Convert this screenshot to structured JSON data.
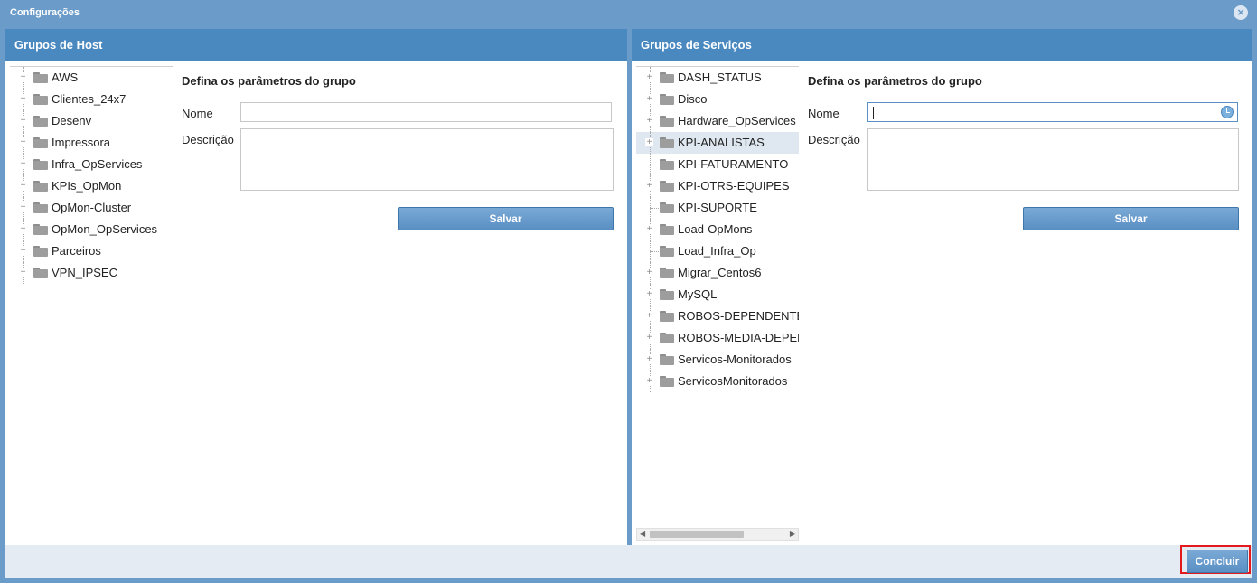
{
  "window": {
    "title": "Configurações",
    "close_icon": "close-icon"
  },
  "host_panel": {
    "header": "Grupos de Host",
    "tree": [
      {
        "label": "AWS",
        "expandable": true
      },
      {
        "label": "Clientes_24x7",
        "expandable": true
      },
      {
        "label": "Desenv",
        "expandable": true
      },
      {
        "label": "Impressora",
        "expandable": true
      },
      {
        "label": "Infra_OpServices",
        "expandable": true
      },
      {
        "label": "KPIs_OpMon",
        "expandable": true
      },
      {
        "label": "OpMon-Cluster",
        "expandable": true
      },
      {
        "label": "OpMon_OpServices",
        "expandable": true
      },
      {
        "label": "Parceiros",
        "expandable": true
      },
      {
        "label": "VPN_IPSEC",
        "expandable": true
      }
    ],
    "form": {
      "title": "Defina os parâmetros do grupo",
      "name_label": "Nome",
      "name_value": "",
      "description_label": "Descrição",
      "description_value": "",
      "save_label": "Salvar"
    }
  },
  "service_panel": {
    "header": "Grupos de Serviços",
    "tree": [
      {
        "label": "DASH_STATUS",
        "expandable": true
      },
      {
        "label": "Disco",
        "expandable": true
      },
      {
        "label": "Hardware_OpServices",
        "expandable": true
      },
      {
        "label": "KPI-ANALISTAS",
        "expandable": true,
        "selected": true
      },
      {
        "label": "KPI-FATURAMENTO",
        "expandable": false
      },
      {
        "label": "KPI-OTRS-EQUIPES",
        "expandable": true
      },
      {
        "label": "KPI-SUPORTE",
        "expandable": false
      },
      {
        "label": "Load-OpMons",
        "expandable": true
      },
      {
        "label": "Load_Infra_Op",
        "expandable": false
      },
      {
        "label": "Migrar_Centos6",
        "expandable": true
      },
      {
        "label": "MySQL",
        "expandable": true
      },
      {
        "label": "ROBOS-DEPENDENTES",
        "expandable": true
      },
      {
        "label": "ROBOS-MEDIA-DEPENDENTES",
        "expandable": true
      },
      {
        "label": "Servicos-Monitorados",
        "expandable": true
      },
      {
        "label": "ServicosMonitorados",
        "expandable": true
      }
    ],
    "form": {
      "title": "Defina os parâmetros do grupo",
      "name_label": "Nome",
      "name_value": "",
      "description_label": "Descrição",
      "description_value": "",
      "save_label": "Salvar"
    }
  },
  "footer": {
    "conclude_label": "Concluir"
  },
  "colors": {
    "header": "#4a88c0",
    "window": "#6b9cc9",
    "highlight": "#e3191b"
  }
}
